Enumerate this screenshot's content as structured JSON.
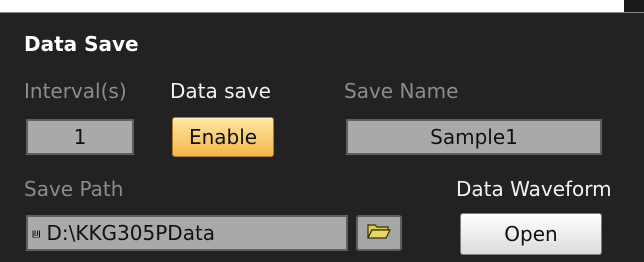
{
  "section": {
    "title": "Data Save"
  },
  "interval": {
    "label": "Interval(s)",
    "value": "1"
  },
  "data_save": {
    "label": "Data save",
    "button_label": "Enable"
  },
  "save_name": {
    "label": "Save Name",
    "value": "Sample1"
  },
  "save_path": {
    "label": "Save Path",
    "value": "D:\\KKG305PData",
    "path_icon": "path-icon",
    "browse_icon": "folder-open-icon"
  },
  "data_waveform": {
    "label": "Data Waveform",
    "button_label": "Open"
  },
  "colors": {
    "panel_bg": "#222222",
    "field_bg": "#a9a9a9",
    "enable_accent": "#f4b64a"
  }
}
